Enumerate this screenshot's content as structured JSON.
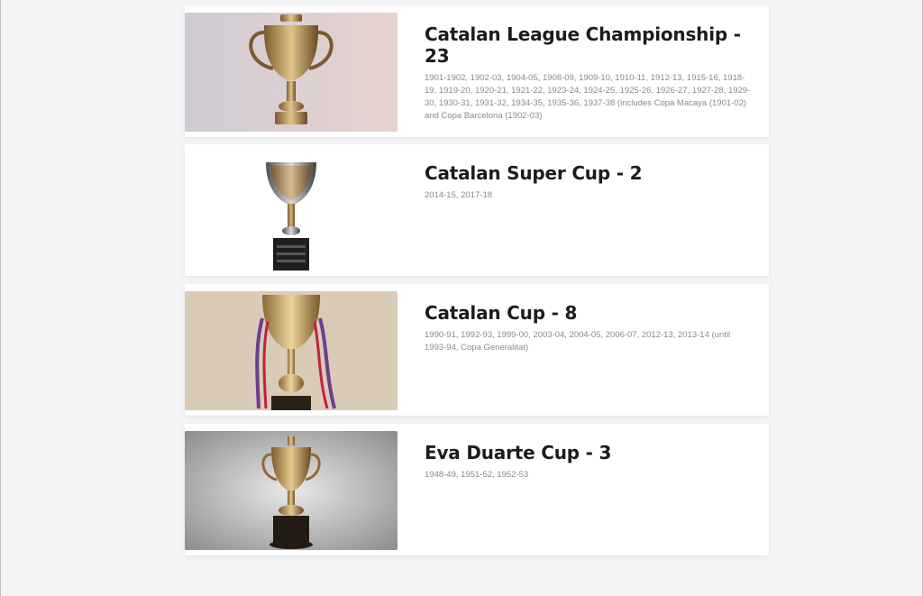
{
  "trophies": [
    {
      "title": "Catalan League Championship - 23",
      "years": "1901-1902, 1902-03, 1904-05, 1908-09, 1909-10, 1910-11, 1912-13, 1915-16, 1918-19, 1919-20, 1920-21, 1921-22, 1923-24, 1924-25, 1925-26, 1926-27, 1927-28, 1929-30, 1930-31, 1931-32, 1934-35, 1935-36, 1937-38 (includes Copa Macaya (1901-02) and Copa Barcelona (1902-03)",
      "image_icon": "trophy-icon"
    },
    {
      "title": "Catalan Super Cup - 2",
      "years": "2014-15, 2017-18",
      "image_icon": "trophy-icon"
    },
    {
      "title": "Catalan Cup - 8",
      "years": "1990-91, 1992-93, 1999-00, 2003-04, 2004-05, 2006-07, 2012-13, 2013-14 (until 1993-94, Copa Generalitat)",
      "image_icon": "trophy-icon"
    },
    {
      "title": "Eva Duarte Cup - 3",
      "years": "1948-49, 1951-52, 1952-53",
      "image_icon": "trophy-icon"
    }
  ],
  "colors": {
    "page_bg": "#f4f4f6",
    "card_bg": "#ffffff",
    "title": "#1c1c1c",
    "meta": "#8a8a8a"
  }
}
